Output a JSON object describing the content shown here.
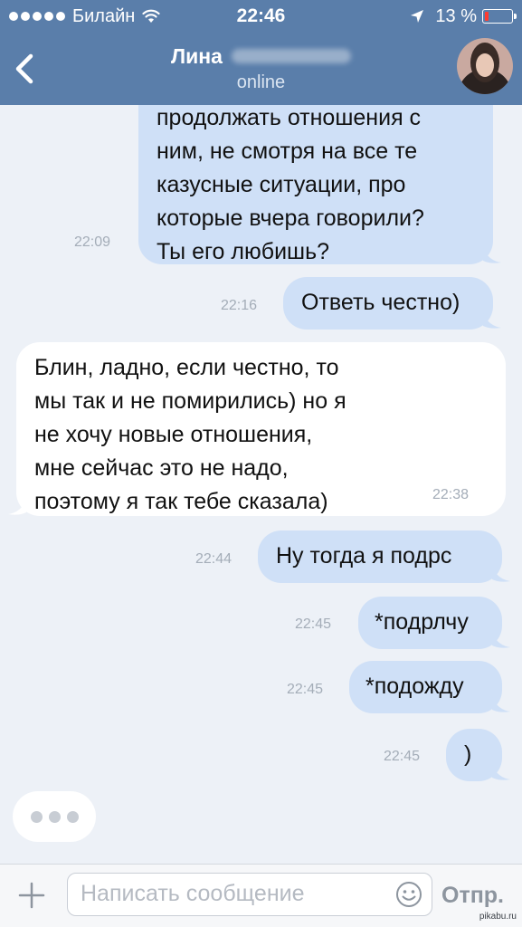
{
  "status_bar": {
    "carrier": "Билайн",
    "time": "22:46",
    "battery_percent": "13 %",
    "battery_level": 0.13,
    "signal_bars": 5,
    "icons": [
      "wifi-icon",
      "location-arrow-icon",
      "battery-icon"
    ]
  },
  "header": {
    "name": "Лина",
    "status": "online",
    "back_icon": "chevron-left-icon",
    "colors": {
      "bar": "#5a7eaa"
    }
  },
  "messages": [
    {
      "direction": "out",
      "lines": [
        "продолжать отношения с",
        "ним, не смотря на все те",
        "казусные ситуации, про",
        "которые вчера говорили?",
        "Ты его любишь?"
      ],
      "time": "22:09"
    },
    {
      "direction": "out",
      "lines": [
        "Ответь честно)"
      ],
      "time": "22:16"
    },
    {
      "direction": "in",
      "lines": [
        "Блин, ладно, если честно, то",
        "мы так и не помирились) но я",
        "не хочу новые отношения,",
        "мне сейчас это не надо,",
        "поэтому я так тебе сказала)"
      ],
      "time": "22:38"
    },
    {
      "direction": "out",
      "lines": [
        "Ну тогда я подрс"
      ],
      "time": "22:44"
    },
    {
      "direction": "out",
      "lines": [
        "*подрлчу"
      ],
      "time": "22:45"
    },
    {
      "direction": "out",
      "lines": [
        "*подожду"
      ],
      "time": "22:45"
    },
    {
      "direction": "out",
      "lines": [
        ")"
      ],
      "time": "22:45"
    }
  ],
  "typing_indicator": "typing-dots-icon",
  "input_bar": {
    "placeholder": "Написать сообщение",
    "send_label": "Отпр.",
    "attach_icon": "plus-icon",
    "emoji_icon": "smiley-icon"
  },
  "watermark": "pikabu.ru",
  "colors": {
    "outgoing_bubble": "#cfe0f7",
    "incoming_bubble": "#ffffff",
    "background": "#edf1f7"
  }
}
